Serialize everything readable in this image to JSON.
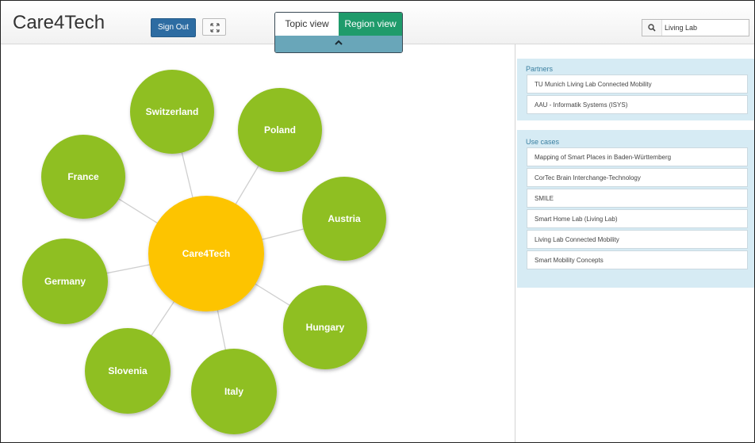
{
  "header": {
    "brand": "Care4Tech",
    "signout_label": "Sign Out",
    "expand_icon": "expand-icon",
    "view_toggle": {
      "topic_label": "Topic view",
      "region_label": "Region view",
      "active": "Region view"
    },
    "collapse_icon": "chevron-up-icon",
    "search": {
      "icon": "search-icon",
      "value": "Living Lab"
    }
  },
  "graph": {
    "center": {
      "label": "Care4Tech",
      "color": "#fdc400"
    },
    "node_color": "#8fbf21",
    "nodes": [
      {
        "label": "Switzerland"
      },
      {
        "label": "Poland"
      },
      {
        "label": "France"
      },
      {
        "label": "Austria"
      },
      {
        "label": "Germany"
      },
      {
        "label": "Hungary"
      },
      {
        "label": "Slovenia"
      },
      {
        "label": "Italy"
      }
    ]
  },
  "sidebar": {
    "partners": {
      "title": "Partners",
      "items": [
        "TU Munich Living Lab Connected Mobility",
        "AAU - Informatik Systems (ISYS)"
      ]
    },
    "use_cases": {
      "title": "Use cases",
      "items": [
        "Mapping of Smart Places in Baden-Württemberg",
        "CorTec Brain Interchange-Technology",
        "SMILE",
        "Smart Home Lab (Living Lab)",
        "Living Lab Connected Mobility",
        "Smart Mobility Concepts"
      ]
    }
  }
}
